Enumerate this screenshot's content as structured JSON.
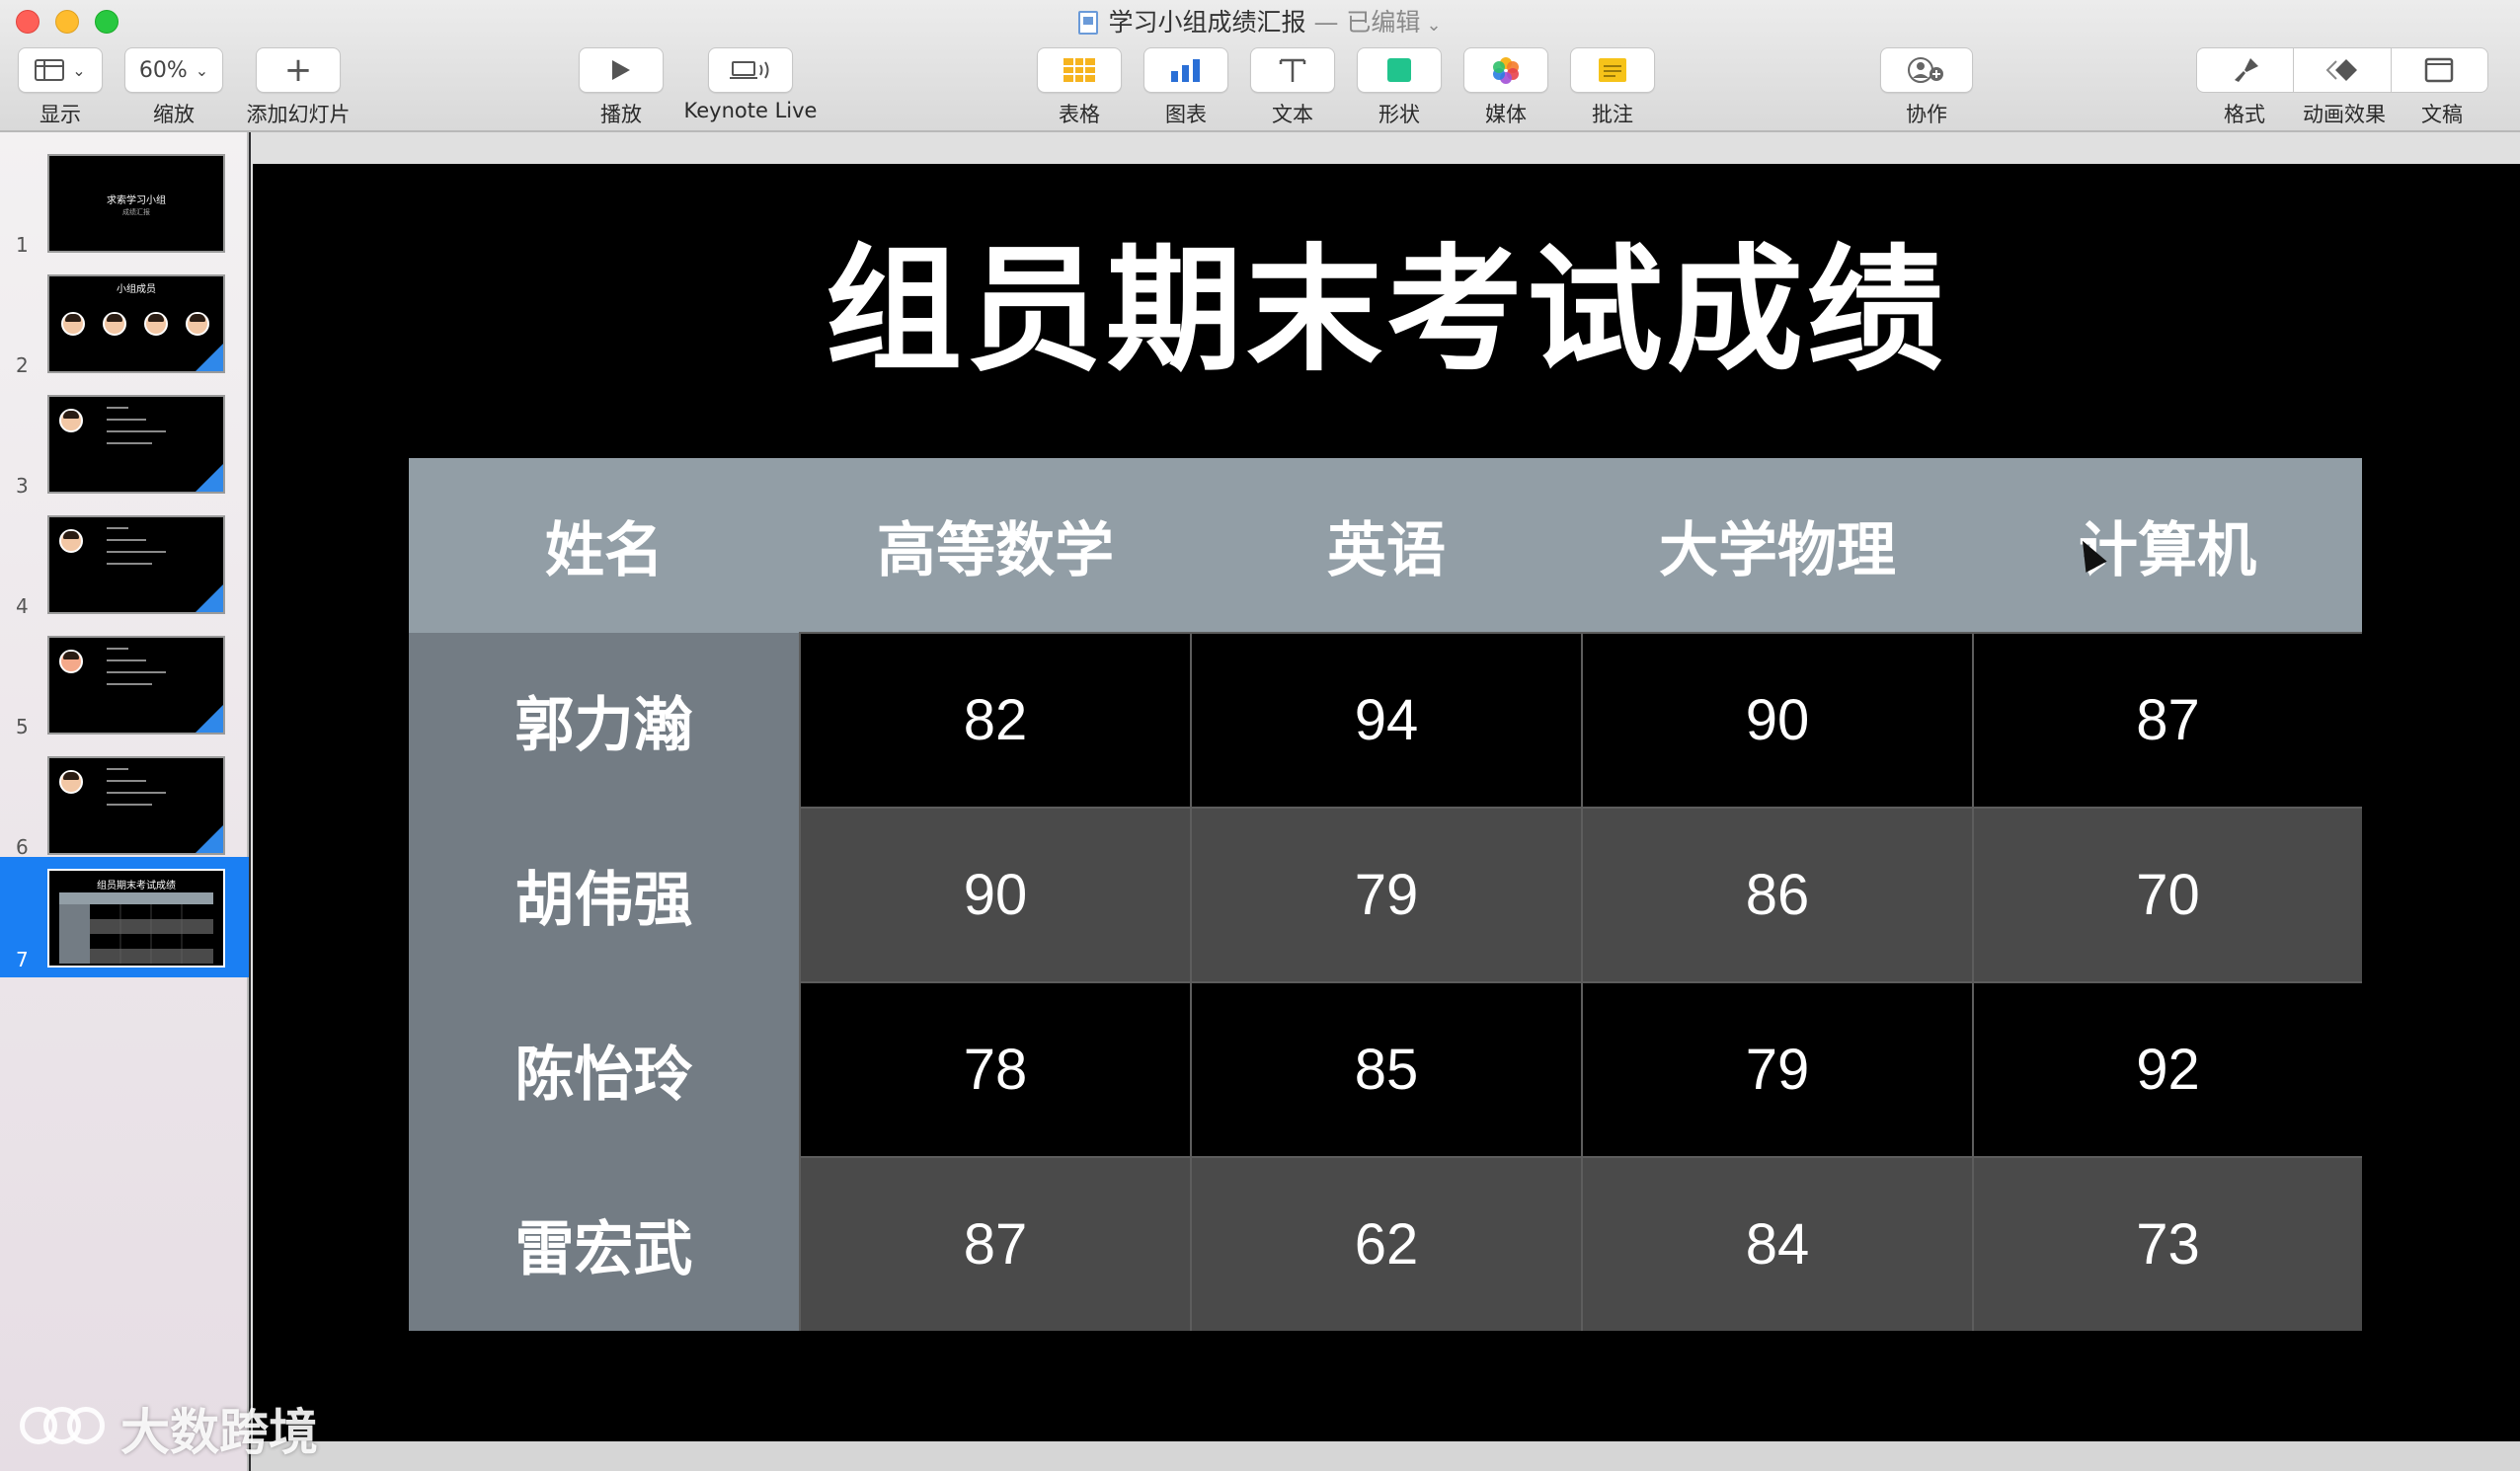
{
  "window": {
    "doc_title": "学习小组成绩汇报",
    "edited": "— 已编辑"
  },
  "toolbar": {
    "view": {
      "label": "显示"
    },
    "zoom": {
      "value": "60%",
      "label": "缩放"
    },
    "add_slide": {
      "label": "添加幻灯片"
    },
    "play": {
      "label": "播放"
    },
    "keynote_live": {
      "label": "Keynote Live"
    },
    "table": {
      "label": "表格"
    },
    "chart": {
      "label": "图表"
    },
    "text": {
      "label": "文本"
    },
    "shape": {
      "label": "形状"
    },
    "media": {
      "label": "媒体"
    },
    "comment": {
      "label": "批注"
    },
    "collaborate": {
      "label": "协作"
    },
    "format": {
      "label": "格式"
    },
    "animate": {
      "label": "动画效果"
    },
    "document": {
      "label": "文稿"
    }
  },
  "colors": {
    "selection_blue": "#1a7ff3",
    "header_gray": "#929ea6",
    "name_col_gray": "#737c84",
    "row_mid": "#4a4a4a"
  },
  "sidebar": {
    "slides": [
      {
        "number": "1",
        "title": "求索学习小组",
        "sub": "成绩汇报"
      },
      {
        "number": "2",
        "title": "小组成员"
      },
      {
        "number": "3"
      },
      {
        "number": "4"
      },
      {
        "number": "5"
      },
      {
        "number": "6"
      },
      {
        "number": "7",
        "title": "组员期末考试成绩"
      }
    ]
  },
  "slide": {
    "title": "组员期末考试成绩",
    "table": {
      "headers": [
        "姓名",
        "高等数学",
        "英语",
        "大学物理",
        "计算机"
      ],
      "rows": [
        {
          "name": "郭力瀚",
          "scores": [
            "82",
            "94",
            "90",
            "87"
          ]
        },
        {
          "name": "胡伟强",
          "scores": [
            "90",
            "79",
            "86",
            "70"
          ]
        },
        {
          "name": "陈怡玲",
          "scores": [
            "78",
            "85",
            "79",
            "92"
          ]
        },
        {
          "name": "雷宏武",
          "scores": [
            "87",
            "62",
            "84",
            "73"
          ]
        }
      ]
    }
  },
  "watermark": {
    "text": "大数跨境"
  }
}
